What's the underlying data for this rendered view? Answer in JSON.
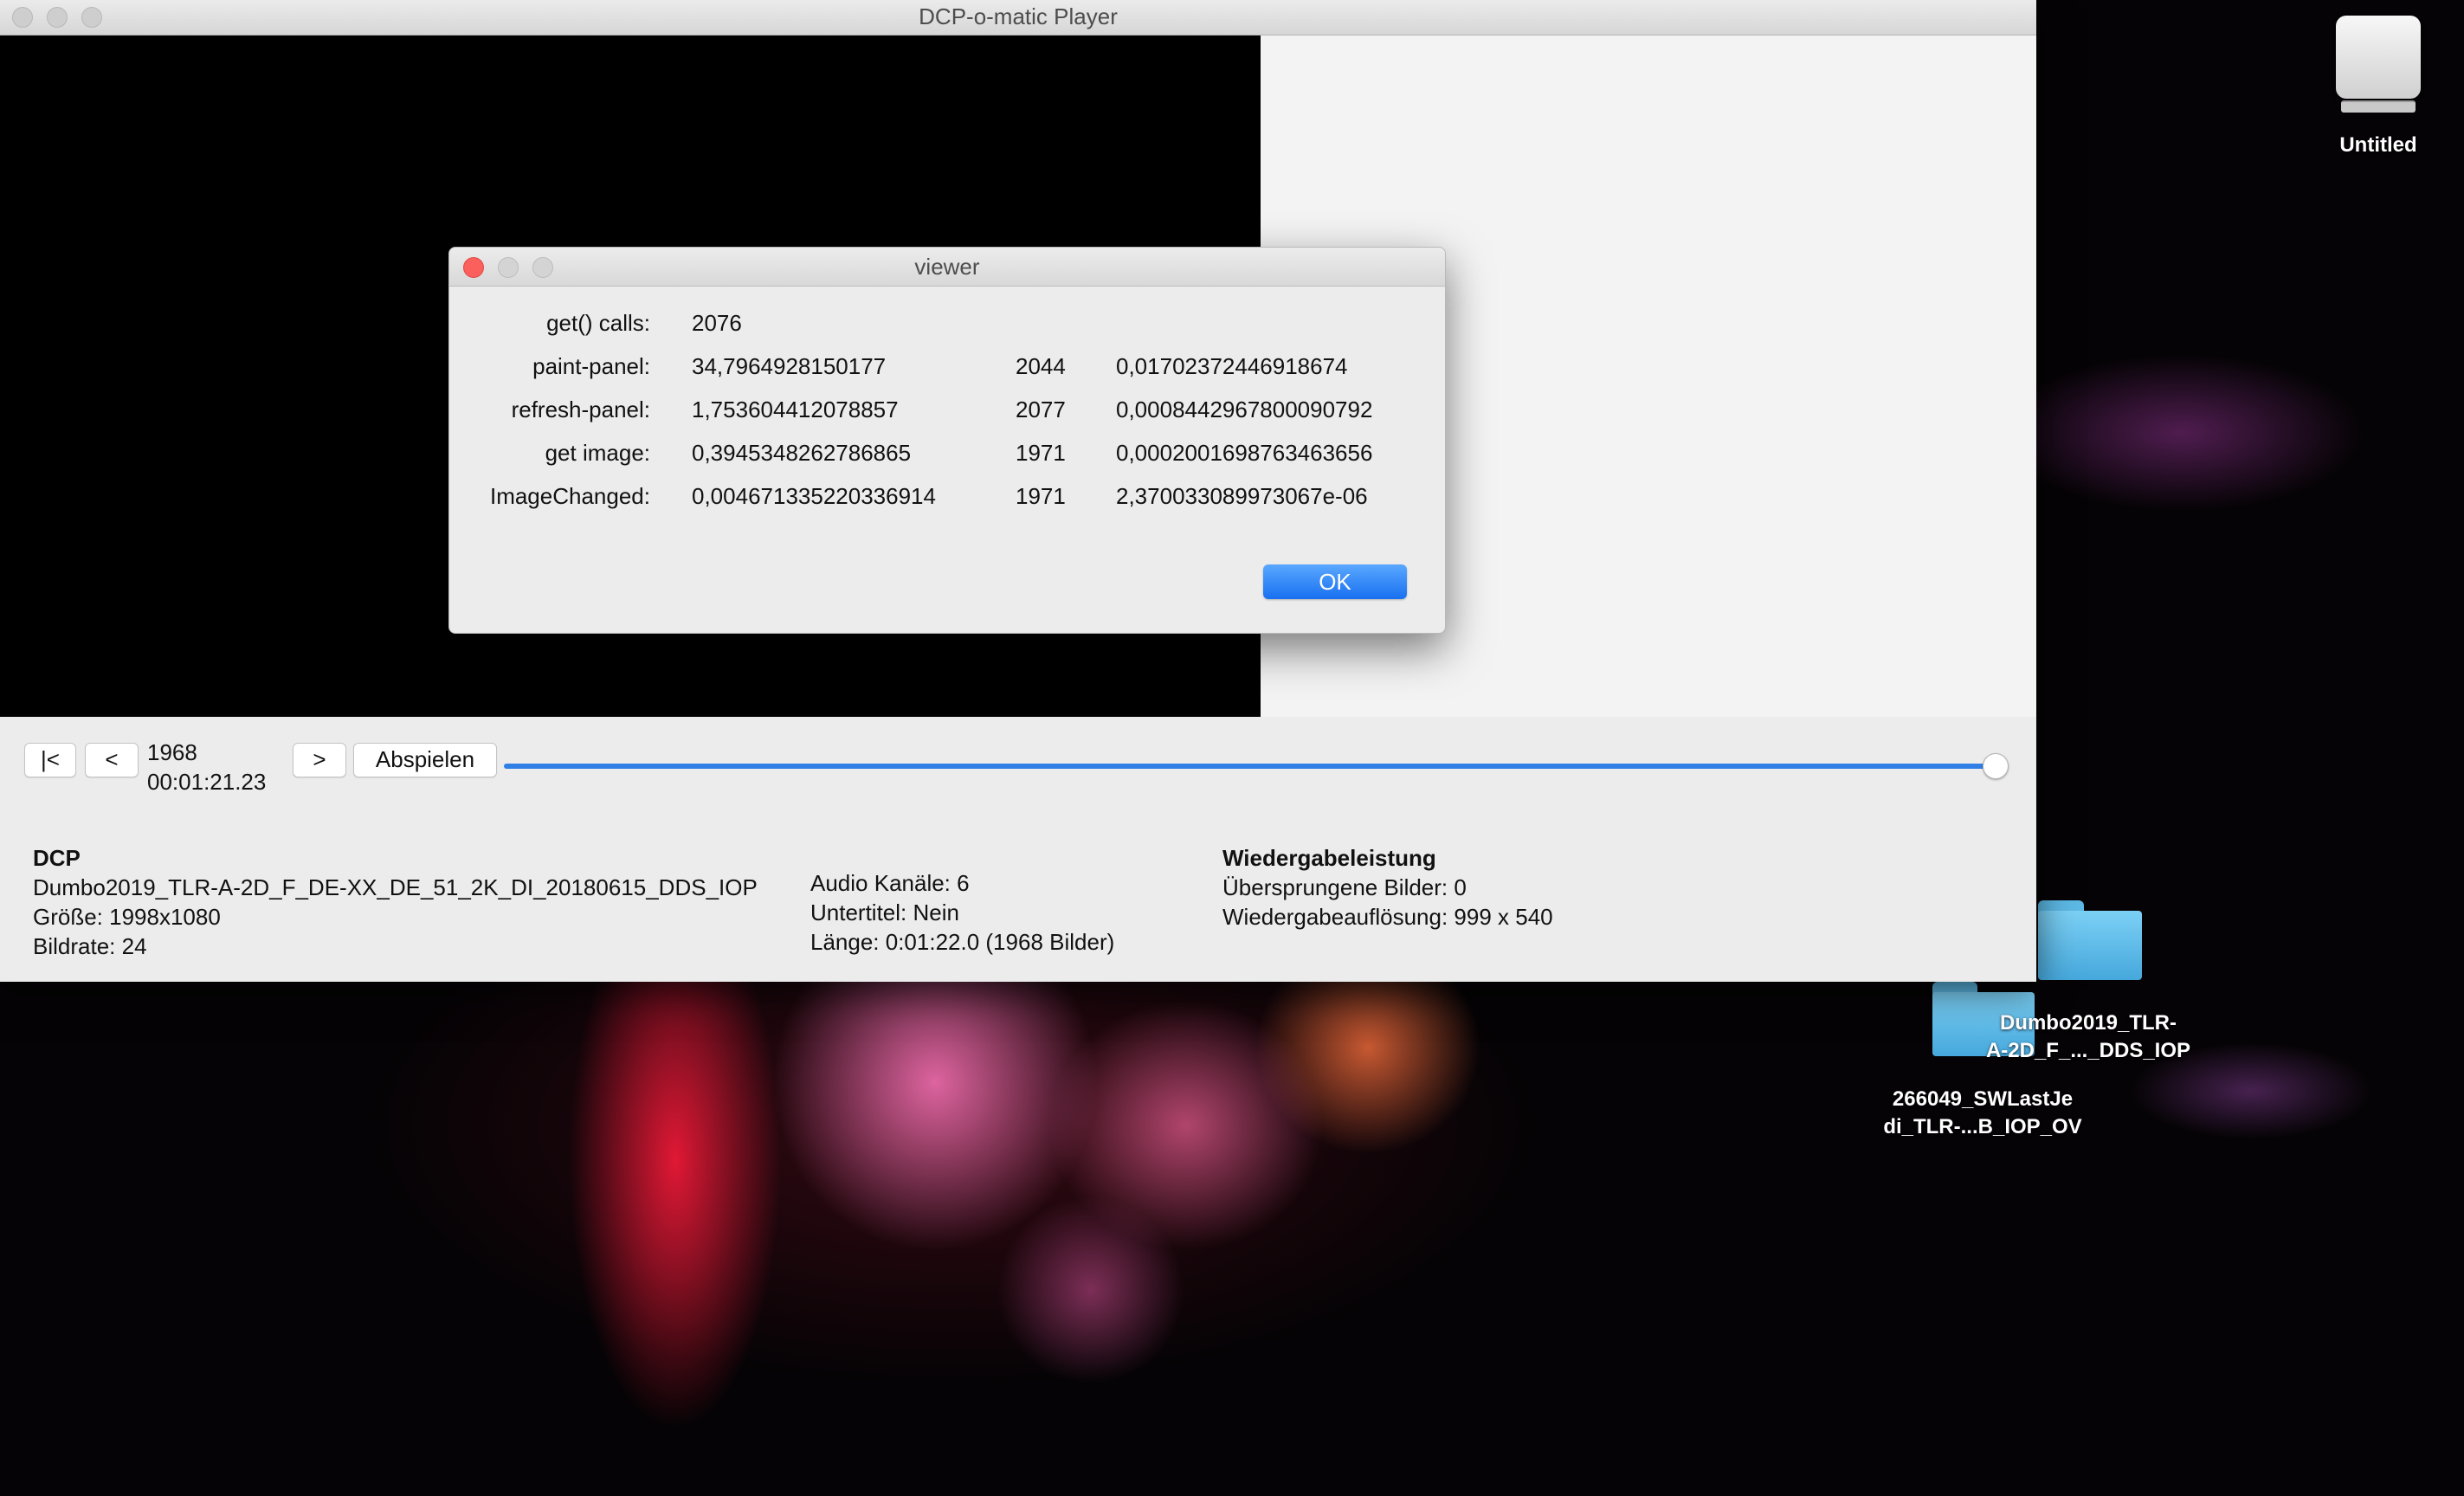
{
  "window": {
    "title": "DCP-o-matic Player"
  },
  "dialog": {
    "title": "viewer",
    "rows": [
      {
        "label": "get() calls:",
        "total": "2076",
        "count": "",
        "average": ""
      },
      {
        "label": "paint-panel:",
        "total": "34,7964928150177",
        "count": "2044",
        "average": "0,01702372446918674"
      },
      {
        "label": "refresh-panel:",
        "total": "1,753604412078857",
        "count": "2077",
        "average": "0,0008442967800090792"
      },
      {
        "label": "get image:",
        "total": "0,3945348262786865",
        "count": "1971",
        "average": "0,0002001698763463656"
      },
      {
        "label": "ImageChanged:",
        "total": "0,004671335220336914",
        "count": "1971",
        "average": "2,370033089973067e-06"
      }
    ],
    "ok_label": "OK"
  },
  "controls": {
    "first_label": "|<",
    "back_label": "<",
    "frame": "1968",
    "timecode": "00:01:21.23",
    "forward_label": ">",
    "play_label": "Abspielen",
    "position_fraction": 1.0
  },
  "info": {
    "dcp_heading": "DCP",
    "dcp_name": "Dumbo2019_TLR-A-2D_F_DE-XX_DE_51_2K_DI_20180615_DDS_IOP",
    "size": "Größe: 1998x1080",
    "framerate": "Bildrate: 24",
    "audio_channels": "Audio Kanäle: 6",
    "subtitles": "Untertitel: Nein",
    "length": "Länge: 0:01:22.0 (1968 Bilder)",
    "perf_heading": "Wiedergabeleistung",
    "dropped_frames": "Übersprungene Bilder: 0",
    "resolution": "Wiedergabeauflösung: 999 x 540"
  },
  "desktop": {
    "drive_label": "Untitled",
    "folder1_label": "Dumbo2019_TLR-A-2D_F_..._DDS_IOP",
    "folder1_line1": "Dumbo2019_TLR-",
    "folder1_line2": "A-2D_F_..._DDS_IOP",
    "folder2_line1": "266049_SWLastJe",
    "folder2_line2": "di_TLR-...B_IOP_OV"
  },
  "colors": {
    "accent": "#2f7fe6",
    "close_red": "#fc605c"
  }
}
